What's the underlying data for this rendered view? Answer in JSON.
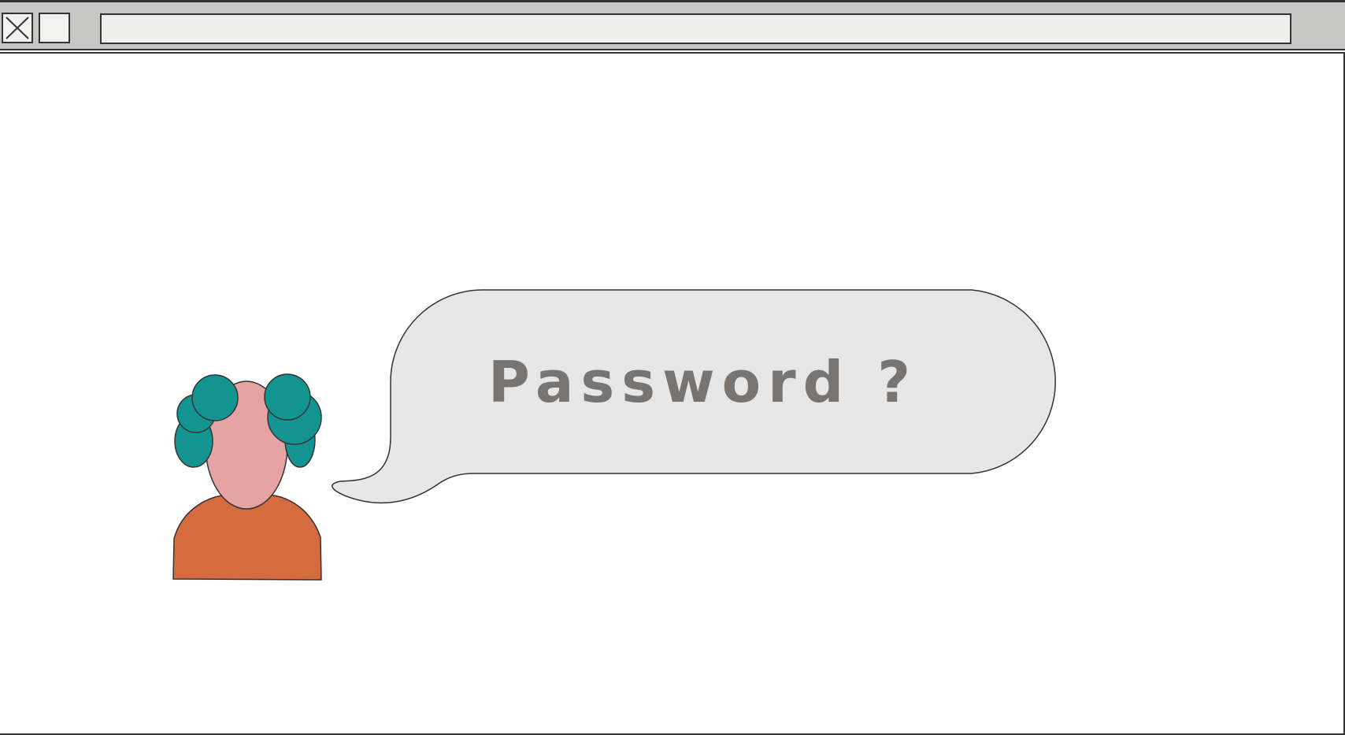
{
  "window": {
    "address_bar": {
      "value": "",
      "placeholder": ""
    },
    "buttons": {
      "close_icon": "close-x-icon",
      "maximize_icon": "maximize-square-icon"
    }
  },
  "illustration": {
    "speech_bubble": {
      "text": "Password ?",
      "fill": "#e7e7e7",
      "text_color": "#777471"
    },
    "person": {
      "hair_color": "#149490",
      "skin_color": "#e5a4a3",
      "shirt_color": "#d56b3f"
    }
  },
  "colors": {
    "titlebar": "#c6c6c4",
    "outline": "#333333",
    "background": "#ffffff"
  }
}
